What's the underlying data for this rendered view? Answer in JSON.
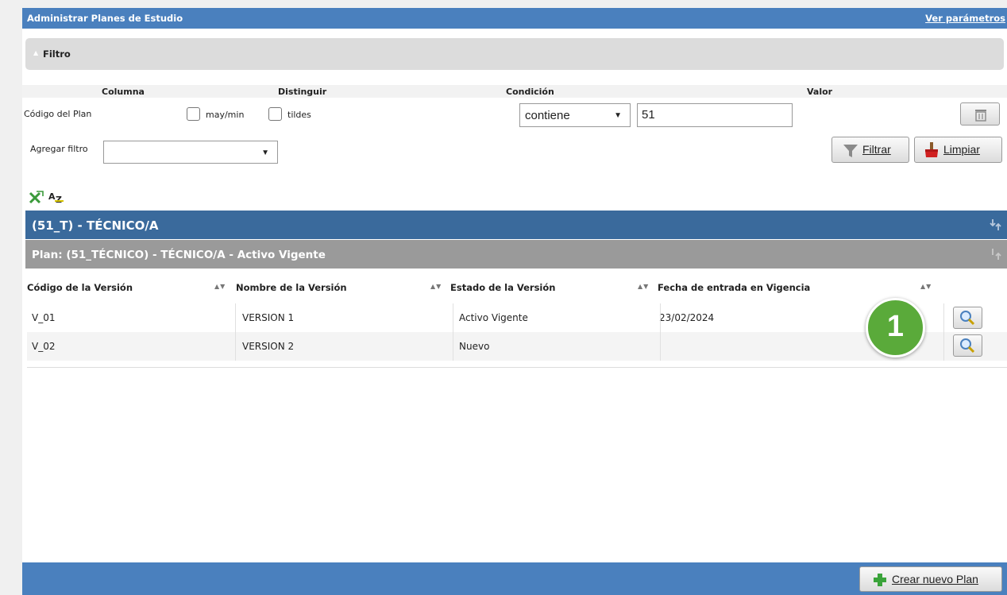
{
  "header": {
    "title": "Administrar Planes de Estudio",
    "link": "Ver parámetros"
  },
  "filter": {
    "toggle_label": "Filtro",
    "columns": {
      "columna": "Columna",
      "distinguir": "Distinguir",
      "condicion": "Condición",
      "valor": "Valor"
    },
    "row": {
      "column_name": "Código del Plan",
      "case_label": "may/min",
      "accents_label": "tildes",
      "condition": "contiene",
      "value": "51"
    },
    "add_filter_label": "Agregar filtro",
    "add_filter_value": "",
    "filter_button": "Filtrar",
    "clear_button": "Limpiar"
  },
  "group": {
    "title": "(51_T) - TÉCNICO/A"
  },
  "plan": {
    "title": "Plan: (51_TÉCNICO) - TÉCNICO/A - Activo Vigente"
  },
  "table": {
    "headers": [
      "Código de la Versión",
      "Nombre de la Versión",
      "Estado de la Versión",
      "Fecha de entrada en Vigencia"
    ],
    "rows": [
      [
        "V_01",
        "VERSION 1",
        "Activo Vigente",
        "23/02/2024"
      ],
      [
        "V_02",
        "VERSION 2",
        "Nuevo",
        ""
      ]
    ]
  },
  "badge": "1",
  "footer": {
    "create_button": "Crear nuevo Plan"
  },
  "colors": {
    "header_blue": "#4a80be",
    "group_blue": "#3a6a9c",
    "plan_gray": "#9a9a9a",
    "badge_green": "#5aaa3a"
  }
}
